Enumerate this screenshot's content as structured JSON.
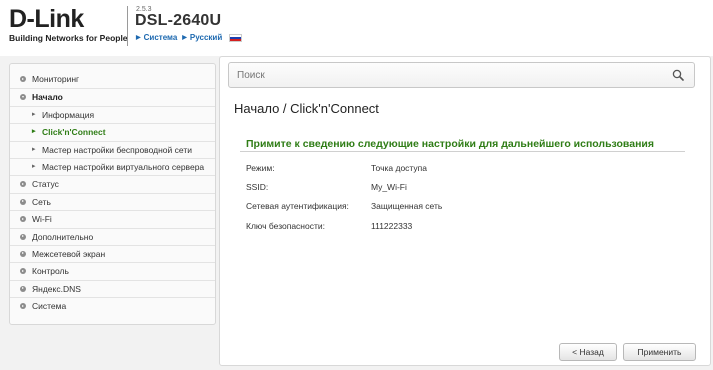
{
  "header": {
    "brand": "D-Link",
    "tagline": "Building Networks for People",
    "firmware": "2.5.3",
    "model": "DSL-2640U",
    "links": [
      "Система",
      "Русский"
    ]
  },
  "sidebar": {
    "items": [
      {
        "label": "Мониторинг",
        "level": 0,
        "state": "closed"
      },
      {
        "label": "Начало",
        "level": 0,
        "state": "open"
      },
      {
        "label": "Информация",
        "level": 1,
        "state": "normal"
      },
      {
        "label": "Click'n'Connect",
        "level": 1,
        "state": "active"
      },
      {
        "label": "Мастер настройки беспроводной сети",
        "level": 1,
        "state": "normal"
      },
      {
        "label": "Мастер настройки виртуального сервера",
        "level": 1,
        "state": "normal"
      },
      {
        "label": "Статус",
        "level": 0,
        "state": "closed"
      },
      {
        "label": "Сеть",
        "level": 0,
        "state": "closed"
      },
      {
        "label": "Wi-Fi",
        "level": 0,
        "state": "closed"
      },
      {
        "label": "Дополнительно",
        "level": 0,
        "state": "closed"
      },
      {
        "label": "Межсетевой экран",
        "level": 0,
        "state": "closed"
      },
      {
        "label": "Контроль",
        "level": 0,
        "state": "closed"
      },
      {
        "label": "Яндекс.DNS",
        "level": 0,
        "state": "closed"
      },
      {
        "label": "Система",
        "level": 0,
        "state": "closed"
      }
    ]
  },
  "search": {
    "placeholder": "Поиск"
  },
  "main": {
    "breadcrumb": "Начало /  Click'n'Connect",
    "section_title": "Примите к сведению следующие настройки для дальнейшего использования",
    "rows": [
      {
        "label": "Режим:",
        "value": "Точка доступа"
      },
      {
        "label": "SSID:",
        "value": "My_Wi-Fi"
      },
      {
        "label": "Сетевая аутентификация:",
        "value": "Защищенная сеть"
      },
      {
        "label": "Ключ безопасности:",
        "value": "111222333"
      }
    ],
    "back_label": "< Назад",
    "apply_label": "Применить"
  },
  "colors": {
    "accent_green": "#2f7d16",
    "link_blue": "#1d69b0"
  }
}
